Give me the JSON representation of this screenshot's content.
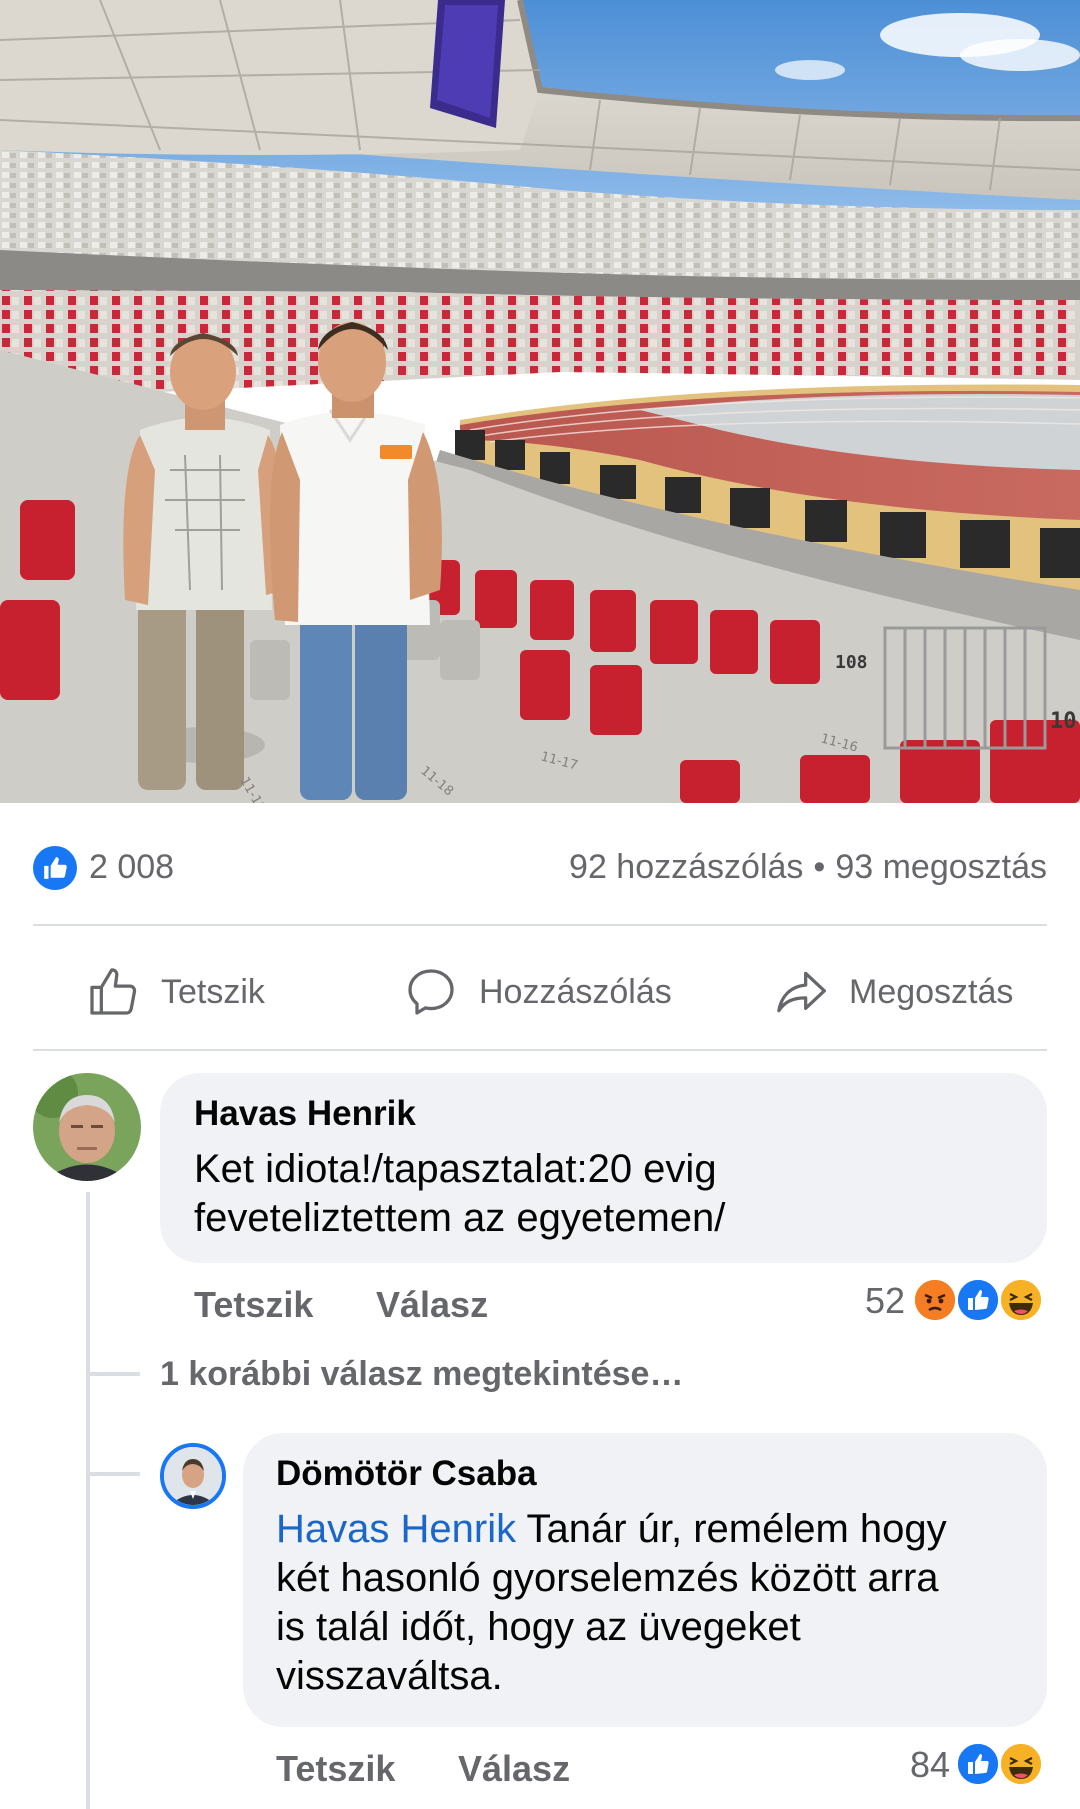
{
  "post": {
    "photo_alt": "stadium-photo",
    "sign_labels": [
      "108",
      "10"
    ],
    "step_labels": [
      "11-18",
      "11-17",
      "11-16",
      "11-18"
    ]
  },
  "stats": {
    "likes": "2 008",
    "comments": "92 hozzászólás",
    "separator": "•",
    "shares": "93 megosztás"
  },
  "actions": {
    "like": "Tetszik",
    "comment": "Hozzászólás",
    "share": "Megosztás"
  },
  "comments": [
    {
      "author": "Havas Henrik",
      "text_line1": "Ket idiota!/tapasztalat:20  evig",
      "text_line2": "feveteliztettem az egyetemen/",
      "like_label": "Tetszik",
      "reply_label": "Válasz",
      "reaction_count": "52"
    }
  ],
  "previous_replies": "1 korábbi válasz megtekintése…",
  "replies": [
    {
      "author": "Dömötör Csaba",
      "mention": "Havas Henrik",
      "text_line1": " Tanár úr, remélem hogy",
      "text_line2": "két hasonló gyorselemzés között arra",
      "text_line3": "is talál időt, hogy az üvegeket",
      "text_line4": "visszaváltsa.",
      "like_label": "Tetszik",
      "reply_label": "Válasz",
      "reaction_count": "84"
    }
  ],
  "colors": {
    "facebook_blue": "#1877f2",
    "secondary_text": "#65676b",
    "bubble": "#f0f2f5",
    "mention": "#1b66c9"
  }
}
